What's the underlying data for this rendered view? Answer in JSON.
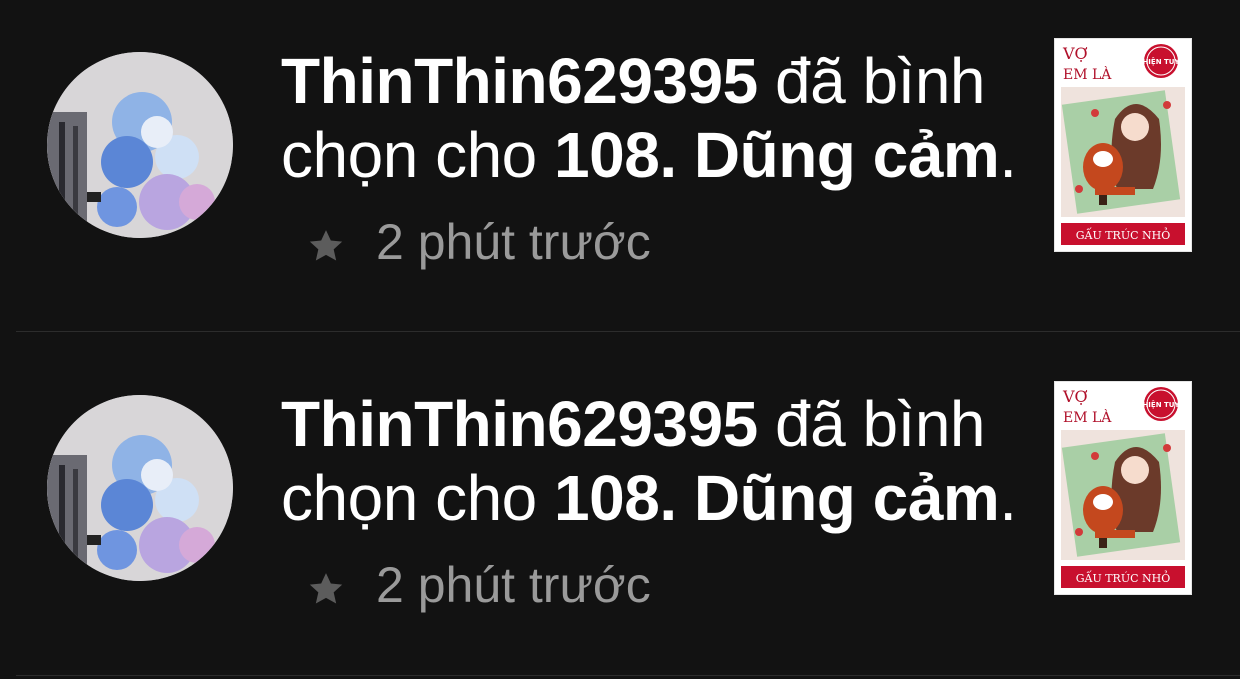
{
  "activity": {
    "items": [
      {
        "user": "ThinThin629395",
        "action_text": " đã bình chọn cho ",
        "chapter": "108. Dũng cảm",
        "end_punct": ".",
        "time": "2 phút trước",
        "avatar_icon": "user-avatar",
        "cover": {
          "title_line1": "VỢ",
          "title_line2": "EM LÀ",
          "stamp": "HIỆN TUY",
          "author": "GẤU TRÚC NHỎ"
        }
      },
      {
        "user": "ThinThin629395",
        "action_text": " đã bình chọn cho ",
        "chapter": "108. Dũng cảm",
        "end_punct": ".",
        "time": "2 phút trước",
        "avatar_icon": "user-avatar",
        "cover": {
          "title_line1": "VỢ",
          "title_line2": "EM LÀ",
          "stamp": "HIỆN TUY",
          "author": "GẤU TRÚC NHỎ"
        }
      }
    ]
  },
  "icons": {
    "vote": "star-icon"
  },
  "colors": {
    "background": "#121212",
    "text_primary": "#ffffff",
    "text_secondary": "#9a9a9a",
    "star": "#5c5c5c",
    "divider": "#2c2c2c",
    "cover_red": "#c8102e"
  }
}
